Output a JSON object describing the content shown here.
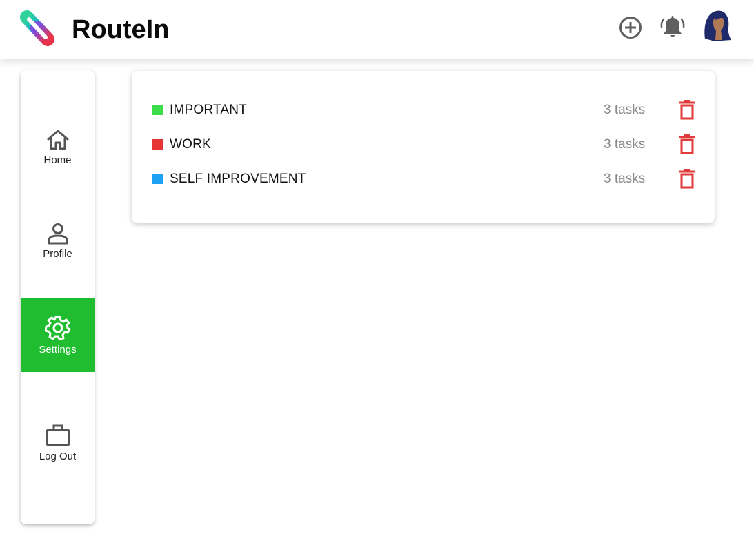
{
  "header": {
    "app_title": "RouteIn",
    "logo_icon": "routein-logo-icon",
    "add_icon": "plus-circle-icon",
    "notification_icon": "alarm-bell-icon",
    "avatar_icon": "user-avatar-icon"
  },
  "sidebar": {
    "items": [
      {
        "label": "Home",
        "icon": "home-icon",
        "active": false
      },
      {
        "label": "Profile",
        "icon": "person-icon",
        "active": false
      },
      {
        "label": "Settings",
        "icon": "gear-icon",
        "active": true
      },
      {
        "label": "Log Out",
        "icon": "briefcase-icon",
        "active": false
      }
    ],
    "active_color": "#1fbd2f"
  },
  "categories": [
    {
      "name": "IMPORTANT",
      "color": "#3ddc4a",
      "count": "3 tasks"
    },
    {
      "name": "WORK",
      "color": "#e53535",
      "count": "3 tasks"
    },
    {
      "name": "SELF IMPROVEMENT",
      "color": "#1da1f2",
      "count": "3 tasks"
    }
  ],
  "colors": {
    "delete": "#e03a3a",
    "count_text": "#8a8a8a"
  }
}
